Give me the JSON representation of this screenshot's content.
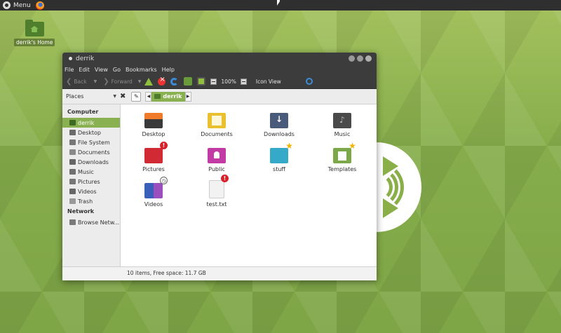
{
  "panel": {
    "menu_label": "Menu",
    "menu_icon": "mint-logo-icon",
    "browser_icon": "firefox-icon"
  },
  "desktop": {
    "home_label": "derrik's Home"
  },
  "window": {
    "title": "derrik",
    "menubar": [
      "File",
      "Edit",
      "View",
      "Go",
      "Bookmarks",
      "Help"
    ],
    "toolbar": {
      "back": "Back",
      "forward": "Forward",
      "zoom": "100%",
      "view": "Icon View"
    },
    "location": {
      "places": "Places",
      "crumb": "derrik"
    },
    "sidebar": {
      "computer_heading": "Computer",
      "items": [
        "derrik",
        "Desktop",
        "File System",
        "Documents",
        "Downloads",
        "Music",
        "Pictures",
        "Videos",
        "Trash"
      ],
      "network_heading": "Network",
      "network_items": [
        "Browse Netw..."
      ]
    },
    "files": [
      {
        "label": "Desktop",
        "icon": "folder-desktop-icon"
      },
      {
        "label": "Documents",
        "icon": "folder-documents-icon"
      },
      {
        "label": "Downloads",
        "icon": "folder-downloads-icon"
      },
      {
        "label": "Music",
        "icon": "folder-music-icon"
      },
      {
        "label": "Pictures",
        "icon": "folder-pictures-icon",
        "emblem": "!"
      },
      {
        "label": "Public",
        "icon": "folder-public-icon"
      },
      {
        "label": "stuff",
        "icon": "folder-icon",
        "emblem": "★"
      },
      {
        "label": "Templates",
        "icon": "folder-templates-icon",
        "emblem": "★"
      },
      {
        "label": "Videos",
        "icon": "folder-videos-icon",
        "emblem": "◷"
      },
      {
        "label": "test.txt",
        "icon": "text-file-icon",
        "emblem": "!"
      }
    ],
    "status": "10 items, Free space: 11.7 GB"
  },
  "colors": {
    "accent": "#8ab151",
    "panel": "#2f2f2f",
    "desktop": "#8bb04e"
  }
}
